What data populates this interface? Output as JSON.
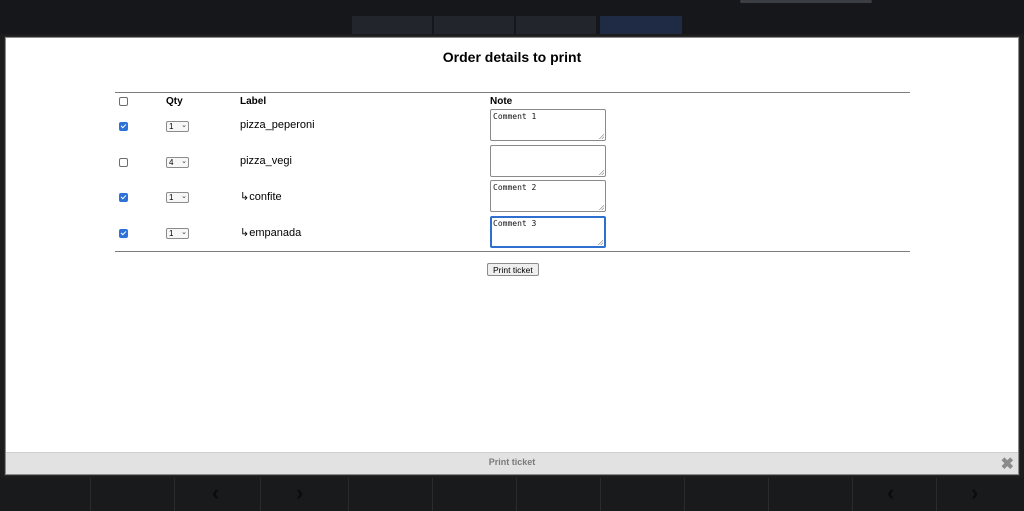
{
  "modal": {
    "title": "Order details to print",
    "table": {
      "headers": {
        "qty": "Qty",
        "label": "Label",
        "note": "Note"
      },
      "select_all_checked": false,
      "rows": [
        {
          "checked": true,
          "qty": "1",
          "label": "pizza_peperoni",
          "note": "Comment 1",
          "focused": false
        },
        {
          "checked": false,
          "qty": "4",
          "label": "pizza_vegi",
          "note": "",
          "focused": false
        },
        {
          "checked": true,
          "qty": "1",
          "label": "↳confite",
          "note": "Comment 2",
          "focused": false
        },
        {
          "checked": true,
          "qty": "1",
          "label": "↳empanada",
          "note": "Comment 3",
          "focused": true
        }
      ]
    },
    "print_button_label": "Print ticket",
    "footer_label": "Print ticket",
    "close_icon": "close-icon"
  },
  "colors": {
    "checkbox_checked": "#2d72d9",
    "focus_ring": "#2f6fd0",
    "footer_bg": "#e2e2e2"
  }
}
